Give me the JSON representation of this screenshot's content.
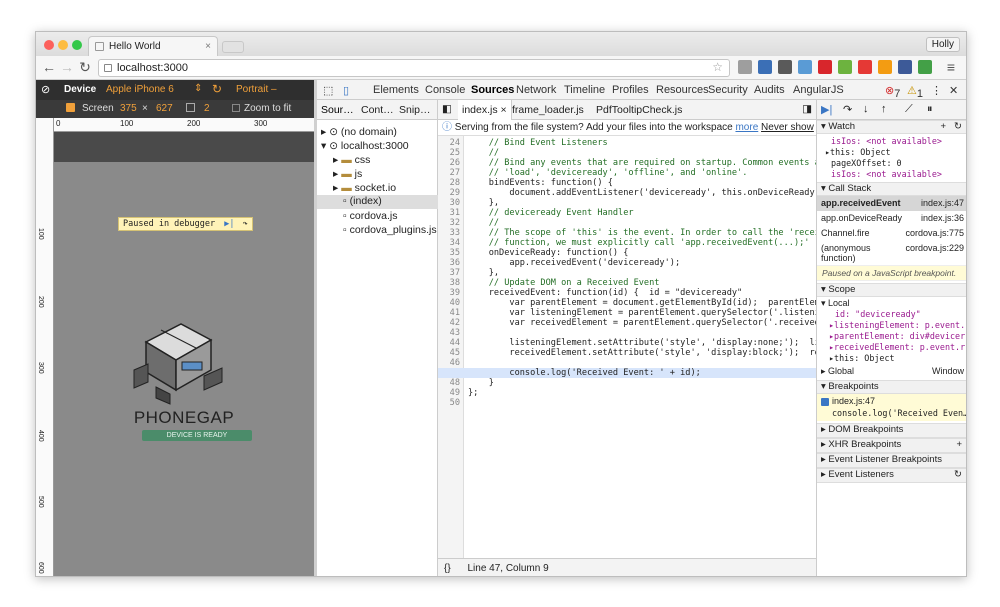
{
  "browser": {
    "tab_title": "Hello World",
    "tab_close": "×",
    "profile": "Holly",
    "url": "localhost:3000"
  },
  "device_toolbar": {
    "device_label": "Device",
    "device_model": "Apple iPhone 6",
    "orientation": "Portrait –",
    "screen_label": "Screen",
    "width": "375",
    "times": "×",
    "height": "627",
    "dpr": "2",
    "zoom_label": "Zoom to fit",
    "paused_text": "Paused in debugger"
  },
  "ruler": {
    "t0": "0",
    "t100": "100",
    "t200": "200",
    "t300": "300",
    "l100": "100",
    "l200": "200",
    "l300": "300",
    "l400": "400",
    "l500": "500",
    "l600": "600"
  },
  "app": {
    "title": "PHONEGAP",
    "status": "DEVICE IS READY",
    "status_color": "#4b8c6a"
  },
  "devtools": {
    "tabs": [
      "Elements",
      "Console",
      "Sources",
      "Network",
      "Timeline",
      "Profiles",
      "Resources",
      "Security",
      "Audits",
      "AngularJS"
    ],
    "active_tab": "Sources",
    "error_count": "7",
    "warn_count": "1",
    "nav_tabs": [
      "Sour…",
      "Cont…",
      "Snip…"
    ],
    "tree": [
      "(no domain)",
      "localhost:3000",
      "css",
      "js",
      "socket.io",
      "(index)",
      "cordova.js",
      "cordova_plugins.js"
    ],
    "editor_tabs": [
      "index.js",
      "frame_loader.js",
      "PdfTooltipCheck.js"
    ],
    "workspace_msg": "Serving from the file system? Add your files into the workspace",
    "more_link": "more",
    "never_link": "Never show",
    "status_bar": "Line 47, Column 9",
    "status_icon": "{}"
  },
  "code_lines": [
    {
      "n": "24",
      "t": "    // Bind Event Listeners"
    },
    {
      "n": "25",
      "t": "    //"
    },
    {
      "n": "26",
      "t": "    // Bind any events that are required on startup. Common events are:"
    },
    {
      "n": "27",
      "t": "    // 'load', 'deviceready', 'offline', and 'online'."
    },
    {
      "n": "28",
      "t": "    bindEvents: function() {"
    },
    {
      "n": "29",
      "t": "        document.addEventListener('deviceready', this.onDeviceReady, fals"
    },
    {
      "n": "30",
      "t": "    },"
    },
    {
      "n": "31",
      "t": "    // deviceready Event Handler"
    },
    {
      "n": "32",
      "t": "    //"
    },
    {
      "n": "33",
      "t": "    // The scope of 'this' is the event. In order to call the 'receivedEv"
    },
    {
      "n": "34",
      "t": "    // function, we must explicitly call 'app.receivedEvent(...);'"
    },
    {
      "n": "35",
      "t": "    onDeviceReady: function() {"
    },
    {
      "n": "36",
      "t": "        app.receivedEvent('deviceready');"
    },
    {
      "n": "37",
      "t": "    },"
    },
    {
      "n": "38",
      "t": "    // Update DOM on a Received Event"
    },
    {
      "n": "39",
      "t": "    receivedEvent: function(id) {  id = \"deviceready\""
    },
    {
      "n": "40",
      "t": "        var parentElement = document.getElementById(id);  parentElement ="
    },
    {
      "n": "41",
      "t": "        var listeningElement = parentElement.querySelector('.listening');"
    },
    {
      "n": "42",
      "t": "        var receivedElement = parentElement.querySelector('.received');"
    },
    {
      "n": "43",
      "t": ""
    },
    {
      "n": "44",
      "t": "        listeningElement.setAttribute('style', 'display:none;');  listen"
    },
    {
      "n": "45",
      "t": "        receivedElement.setAttribute('style', 'display:block;');  receive"
    },
    {
      "n": "46",
      "t": ""
    },
    {
      "n": "47",
      "t": "        console.log('Received Event: ' + id);"
    },
    {
      "n": "48",
      "t": "    }"
    },
    {
      "n": "49",
      "t": "};"
    },
    {
      "n": "50",
      "t": ""
    }
  ],
  "sidebar": {
    "watch_label": "Watch",
    "watch": [
      "isIos: <not available>",
      "this: Object",
      "pageXOffset: 0",
      "isIos: <not available>"
    ],
    "callstack_label": "Call Stack",
    "callstack": [
      {
        "fn": "app.receivedEvent",
        "loc": "index.js:47"
      },
      {
        "fn": "app.onDeviceReady",
        "loc": "index.js:36"
      },
      {
        "fn": "Channel.fire",
        "loc": "cordova.js:775"
      },
      {
        "fn": "(anonymous function)",
        "loc": "cordova.js:229"
      }
    ],
    "paused_msg": "Paused on a JavaScript breakpoint.",
    "scope_label": "Scope",
    "local_label": "Local",
    "scope": [
      "id: \"deviceready\"",
      "listeningElement: p.event.",
      "parentElement: div#devicer",
      "receivedElement: p.event.r",
      "this: Object"
    ],
    "global_label": "Global",
    "global_value": "Window",
    "breakpoints_label": "Breakpoints",
    "bp_file": "index.js:47",
    "bp_code": "console.log('Received Even…",
    "dom_bp": "DOM Breakpoints",
    "xhr_bp": "XHR Breakpoints",
    "event_bp": "Event Listener Breakpoints",
    "event_listeners": "Event Listeners"
  }
}
